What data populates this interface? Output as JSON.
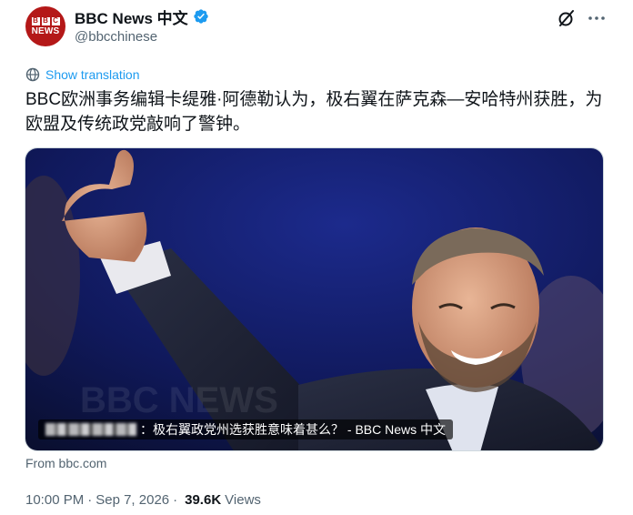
{
  "account": {
    "display_name": "BBC News 中文",
    "handle": "@bbcchinese",
    "avatar_letters": [
      "B",
      "B",
      "C"
    ],
    "avatar_text": "NEWS",
    "verified_color": "#1d9bf0",
    "avatar_color": "#b41818"
  },
  "header_icons": [
    "grok-icon",
    "more-icon"
  ],
  "translation": {
    "label": "Show translation",
    "icon": "globe-icon"
  },
  "tweet": {
    "text": "BBC欧洲事务编辑卡缇雅·阿德勒认为，极右翼在萨克森—安哈特州获胜，为欧盟及传统政党敲响了警钟。"
  },
  "media": {
    "caption": "：极右翼政党州选获胜意味着甚么？ - BBC News 中文",
    "watermark": "BBC NEWS",
    "from_label": "From bbc.com"
  },
  "meta": {
    "time": "10:00 PM",
    "dot1": "·",
    "date": "Sep 7, 2026",
    "dot2": "·",
    "views_count": "39.6K",
    "views_label": "Views"
  },
  "colors": {
    "accent": "#1d9bf0",
    "secondary_text": "#536471",
    "primary_text": "#0f1419"
  }
}
